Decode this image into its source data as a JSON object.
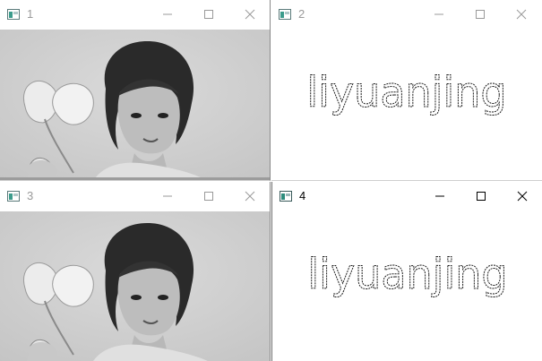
{
  "windows": [
    {
      "title": "1",
      "content_type": "grayscale-photo",
      "active": false
    },
    {
      "title": "2",
      "content_type": "edge-text",
      "text": "liyuanjing",
      "active": false
    },
    {
      "title": "3",
      "content_type": "grayscale-photo",
      "active": false
    },
    {
      "title": "4",
      "content_type": "edge-text",
      "text": "liyuanjing",
      "active": true
    }
  ],
  "colors": {
    "inactive_title": "#9a9a9a",
    "active_title": "#000000",
    "photo_background": "#d4d4d4",
    "text_stroke": "#1a1a1a"
  },
  "icons": {
    "app": "app-window-icon",
    "minimize": "minimize-icon",
    "maximize": "maximize-icon",
    "close": "close-icon"
  }
}
